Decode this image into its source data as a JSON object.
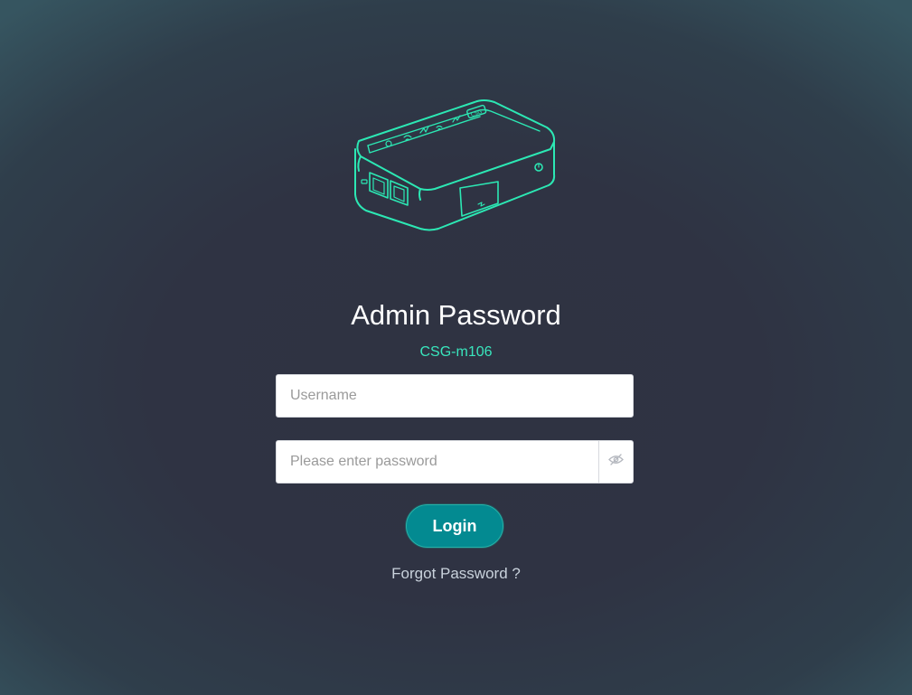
{
  "page": {
    "title": "Admin Password",
    "model_name": "CSG-m106"
  },
  "form": {
    "username": {
      "value": "",
      "placeholder": "Username"
    },
    "password": {
      "value": "",
      "placeholder": "Please enter password",
      "visibility_icon": "eye-hidden-icon"
    },
    "login_label": "Login",
    "forgot_label": "Forgot Password ?"
  },
  "device": {
    "icon": "router-device-illustration",
    "badge_text": "CSG"
  },
  "colors": {
    "accent_teal": "#39e6bd",
    "button_teal": "#038a91",
    "background_dark": "#2f3343"
  }
}
